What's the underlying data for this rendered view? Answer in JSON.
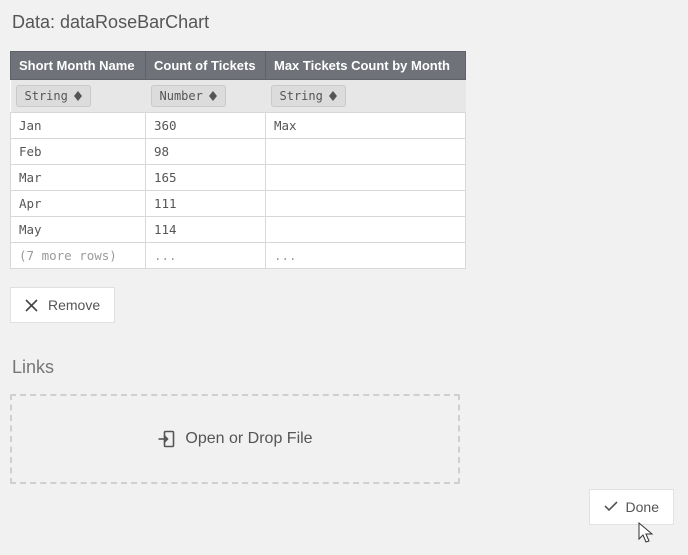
{
  "section_title": "Data: dataRoseBarChart",
  "table": {
    "columns": [
      {
        "header": "Short Month Name",
        "type": "String"
      },
      {
        "header": "Count of Tickets",
        "type": "Number"
      },
      {
        "header": "Max Tickets Count by Month",
        "type": "String"
      }
    ],
    "rows": [
      [
        "Jan",
        "360",
        "Max"
      ],
      [
        "Feb",
        "98",
        ""
      ],
      [
        "Mar",
        "165",
        ""
      ],
      [
        "Apr",
        "111",
        ""
      ],
      [
        "May",
        "114",
        ""
      ]
    ],
    "more_row": [
      "(7 more rows)",
      "...",
      "..."
    ]
  },
  "remove_label": "Remove",
  "links_title": "Links",
  "dropzone_label": "Open or Drop File",
  "done_label": "Done"
}
